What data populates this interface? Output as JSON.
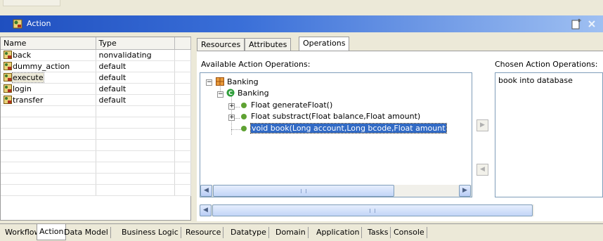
{
  "window": {
    "title": "Action"
  },
  "actions_table": {
    "columns": [
      "Name",
      "Type"
    ],
    "rows": [
      {
        "name": "back",
        "type": "nonvalidating"
      },
      {
        "name": "dummy_action",
        "type": "default"
      },
      {
        "name": "execute",
        "type": "default"
      },
      {
        "name": "login",
        "type": "default"
      },
      {
        "name": "transfer",
        "type": "default"
      }
    ],
    "selected": "execute"
  },
  "detail_tabs": [
    "Resources",
    "Attributes",
    "Operations"
  ],
  "active_detail_tab": "Operations",
  "operations": {
    "available_label": "Available Action Operations:",
    "chosen_label": "Chosen Action Operations:",
    "tree": {
      "package": "Banking",
      "class": "Banking",
      "methods": [
        "Float generateFloat()",
        "Float substract(Float balance,Float amount)",
        "void book(Long account,Long bcode,Float amount"
      ],
      "selected_method": "void book(Long account,Long bcode,Float amount"
    },
    "chosen_items": [
      "book into database"
    ]
  },
  "bottom_tabs": [
    "Workflow",
    "Action",
    "Data Model",
    "Business Logic",
    "Resource",
    "Datatype",
    "Domain",
    "Application",
    "Tasks",
    "Console"
  ],
  "active_bottom_tab": "Action",
  "colors": {
    "title_gradient_start": "#1f4fbf",
    "selection": "#316ac5",
    "method_dot": "#5fa233",
    "class_icon": "#2e9e3a"
  }
}
